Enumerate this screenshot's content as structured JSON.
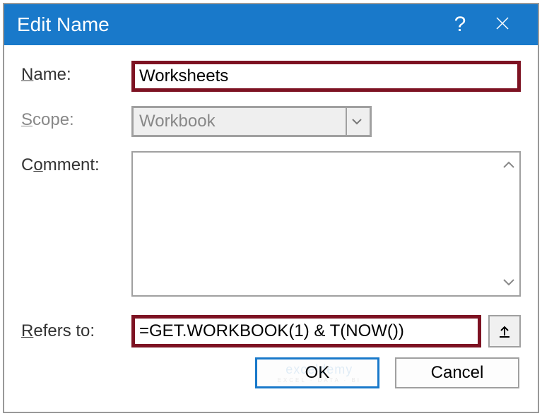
{
  "titlebar": {
    "title": "Edit Name",
    "help": "?"
  },
  "labels": {
    "name": "ame:",
    "name_prefix": "N",
    "scope": "cope:",
    "scope_prefix": "S",
    "comment": "omment:",
    "comment_prefix": "C",
    "refers": "efers to:",
    "refers_prefix": "R"
  },
  "fields": {
    "name_value": "Worksheets",
    "scope_value": "Workbook",
    "comment_value": "",
    "refers_value": "=GET.WORKBOOK(1) & T(NOW())"
  },
  "buttons": {
    "ok": "OK",
    "cancel": "Cancel"
  },
  "watermark": {
    "main": "exceldemy",
    "sub": "EXCEL · DATA · BI"
  }
}
